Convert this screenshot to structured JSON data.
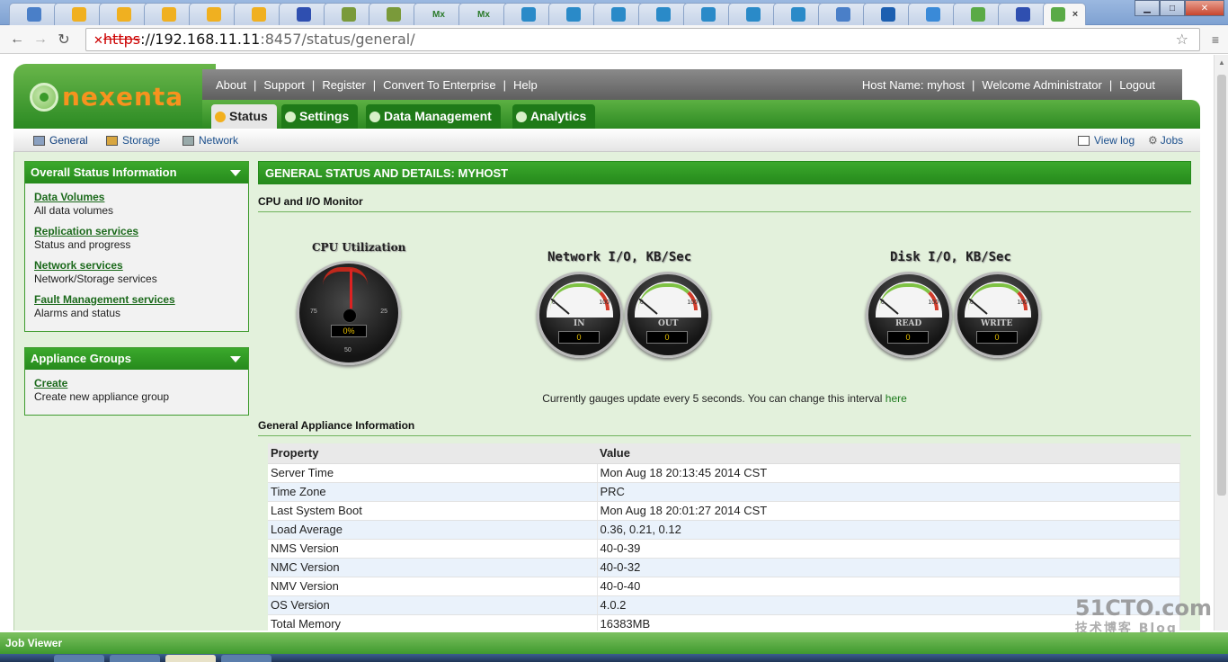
{
  "browser": {
    "tab_icons": [
      "doc-icon",
      "smiley-icon",
      "smiley-icon",
      "smiley-icon",
      "smiley-icon",
      "smiley-icon",
      "paw-icon",
      "chart-icon",
      "chart-icon",
      "mx-icon",
      "mx-icon",
      "play-icon",
      "play-icon",
      "play-icon",
      "play-icon",
      "play-icon",
      "play-icon",
      "play-icon",
      "doc-icon",
      "home-icon",
      "box-icon",
      "nexenta-icon",
      "paw-icon"
    ],
    "tab_glyphs": {
      "mx-icon": "Mx"
    },
    "active_tab_close": "×",
    "url_scheme": "https",
    "url_host": "://192.168.11.11",
    "url_rest": ":8457/status/general/"
  },
  "header": {
    "logo_text": "nexenta",
    "top_links": [
      "About",
      "Support",
      "Register",
      "Convert To Enterprise",
      "Help"
    ],
    "host_name": "Host Name: myhost",
    "welcome": "Welcome Administrator",
    "logout": "Logout",
    "main_tabs": [
      "Status",
      "Settings",
      "Data Management",
      "Analytics"
    ]
  },
  "subnav": {
    "items": [
      "General",
      "Storage",
      "Network"
    ],
    "view_log": "View log",
    "jobs": "Jobs"
  },
  "sidebar": {
    "overall_title": "Overall Status Information",
    "overall_items": [
      {
        "link": "Data Volumes",
        "desc": "All data volumes"
      },
      {
        "link": "Replication services",
        "desc": "Status and progress"
      },
      {
        "link": "Network services",
        "desc": "Network/Storage services"
      },
      {
        "link": "Fault Management services",
        "desc": "Alarms and status"
      }
    ],
    "groups_title": "Appliance Groups",
    "groups_items": [
      {
        "link": "Create",
        "desc": "Create new appliance group"
      }
    ]
  },
  "content": {
    "title": "GENERAL STATUS AND DETAILS: MYHOST",
    "monitor_title": "CPU and I/O Monitor",
    "cpu_label": "CPU Utilization",
    "cpu_value": "0%",
    "cpu_ticks": [
      "75",
      "25",
      "50"
    ],
    "network_label": "Network I/O, KB/Sec",
    "disk_label": "Disk I/O, KB/Sec",
    "gauge_min": "0",
    "gauge_max": "100",
    "gauges": [
      {
        "caption": "IN",
        "value": "0"
      },
      {
        "caption": "OUT",
        "value": "0"
      },
      {
        "caption": "READ",
        "value": "0"
      },
      {
        "caption": "WRITE",
        "value": "0"
      }
    ],
    "note": "Currently gauges update every 5 seconds. You can change this interval",
    "note_link": "here",
    "general_title": "General Appliance Information",
    "table_headers": [
      "Property",
      "Value"
    ],
    "table_rows": [
      [
        "Server Time",
        "Mon Aug 18 20:13:45 2014 CST"
      ],
      [
        "Time Zone",
        "PRC"
      ],
      [
        "Last System Boot",
        "Mon Aug 18 20:01:27 2014 CST"
      ],
      [
        "Load Average",
        "0.36, 0.21, 0.12"
      ],
      [
        "NMS Version",
        "40-0-39"
      ],
      [
        "NMC Version",
        "40-0-32"
      ],
      [
        "NMV Version",
        "40-0-40"
      ],
      [
        "OS Version",
        "4.0.2"
      ],
      [
        "Total Memory",
        "16383MB"
      ]
    ]
  },
  "footer": {
    "job_viewer": "Job Viewer"
  },
  "watermark": {
    "main": "51CTO.com",
    "sub": "技术博客 Blog"
  }
}
